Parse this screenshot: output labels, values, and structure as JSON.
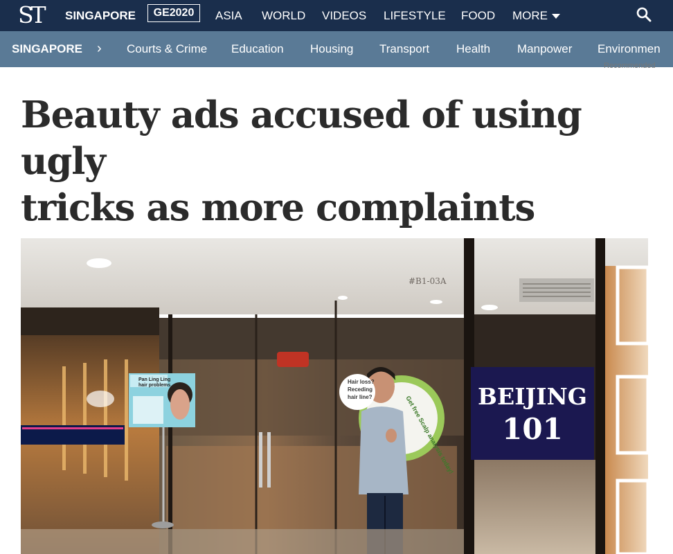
{
  "brand": {
    "logo": "ST"
  },
  "topnav": {
    "items": [
      "SINGAPORE",
      "GE2020",
      "ASIA",
      "WORLD",
      "VIDEOS",
      "LIFESTYLE",
      "FOOD",
      "MORE"
    ]
  },
  "subnav": {
    "section": "SINGAPORE",
    "items": [
      "Courts & Crime",
      "Education",
      "Housing",
      "Transport",
      "Health",
      "Manpower",
      "Environmen"
    ]
  },
  "recommended": "Recommended",
  "article": {
    "headline_line1": "Beauty ads accused of using ugly",
    "headline_line2": "tricks as more complaints lodged"
  },
  "photo": {
    "unit_number": "#B1-03A",
    "sign_line1": "BEIJING",
    "sign_line2": "101",
    "bubble_line1": "Hair loss?",
    "bubble_line2": "Receding",
    "bubble_line3": "hair line?",
    "circle_text": "Get free Scalp analysis today!",
    "poster_title": "Pan Ling Ling",
    "poster_subtitle": "hair problems"
  },
  "colors": {
    "topbar": "#1a2e4c",
    "subbar": "#5a7a96",
    "headline": "#2b2b2b"
  },
  "icons": {
    "search": "search-icon",
    "more": "chevron-down-icon",
    "breadcrumb": "chevron-right-icon"
  }
}
